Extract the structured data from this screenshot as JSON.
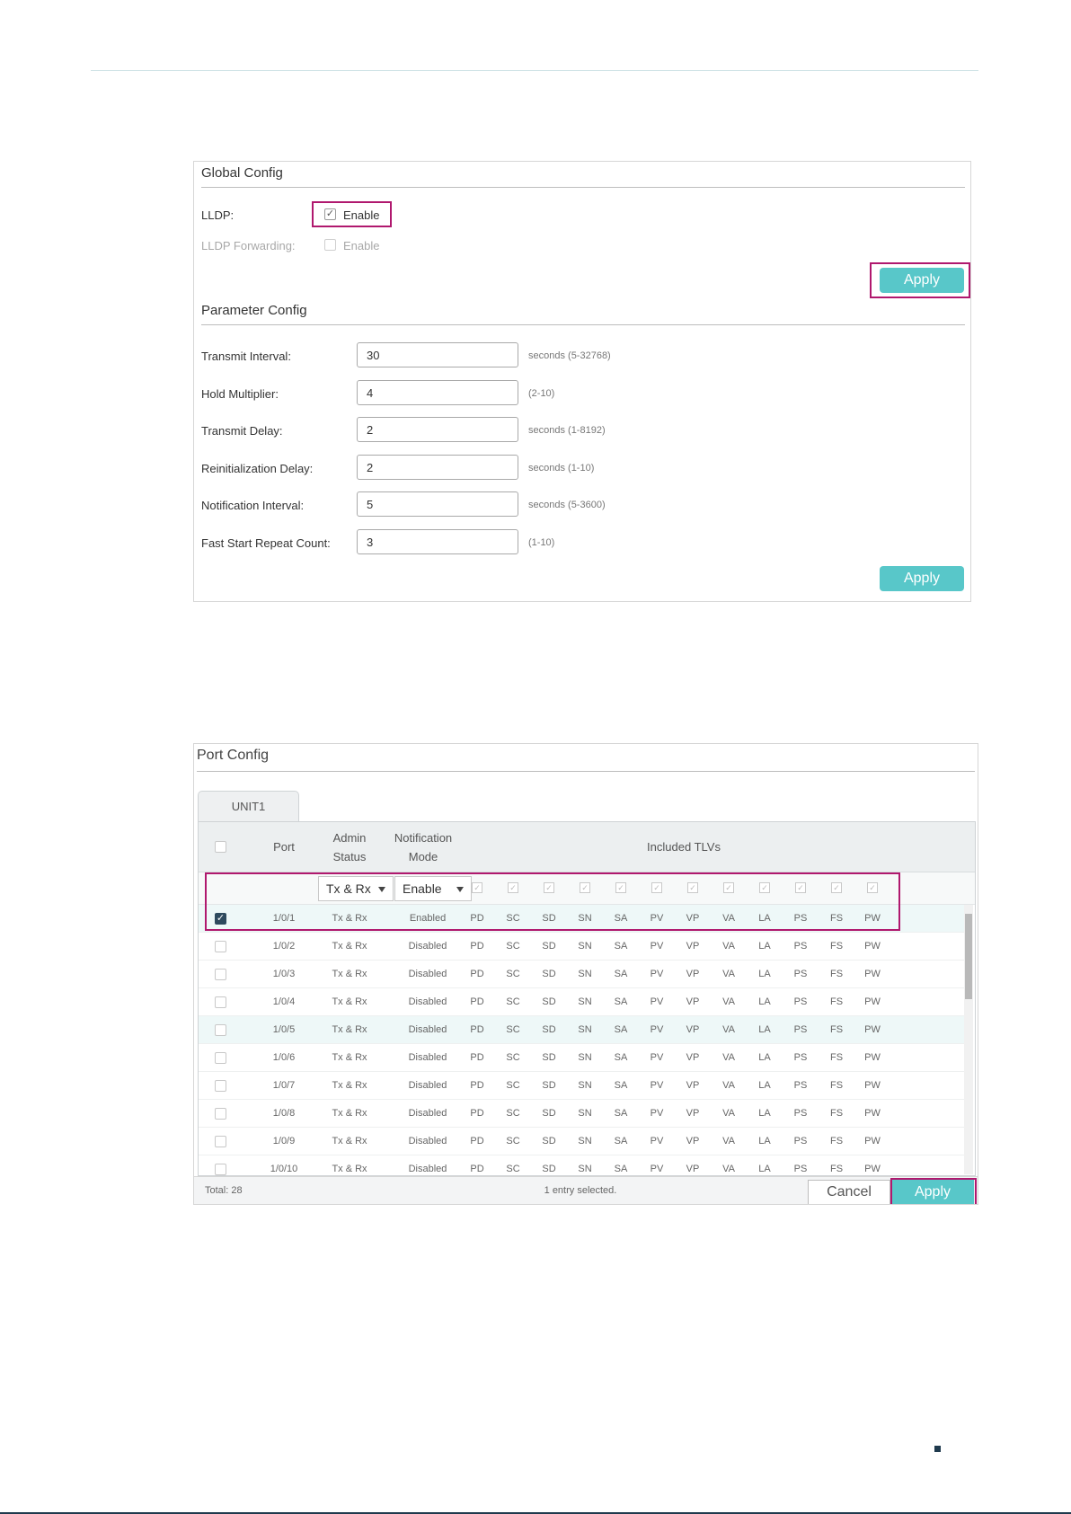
{
  "global_config": {
    "title": "Global Config",
    "lldp_label": "LLDP:",
    "lldp_enable_text": "Enable",
    "lldp_checked": true,
    "forwarding_label": "LLDP Forwarding:",
    "forwarding_enable_text": "Enable",
    "forwarding_checked": false,
    "apply_label": "Apply"
  },
  "parameter_config": {
    "title": "Parameter Config",
    "fields": [
      {
        "label": "Transmit Interval:",
        "value": "30",
        "hint": "seconds (5-32768)"
      },
      {
        "label": "Hold Multiplier:",
        "value": "4",
        "hint": "(2-10)"
      },
      {
        "label": "Transmit Delay:",
        "value": "2",
        "hint": "seconds (1-8192)"
      },
      {
        "label": "Reinitialization Delay:",
        "value": "2",
        "hint": "seconds (1-10)"
      },
      {
        "label": "Notification Interval:",
        "value": "5",
        "hint": "seconds (5-3600)"
      },
      {
        "label": "Fast Start Repeat Count:",
        "value": "3",
        "hint": "(1-10)"
      }
    ],
    "apply_label": "Apply"
  },
  "port_config": {
    "title": "Port Config",
    "tab": "UNIT1",
    "headers": {
      "port": "Port",
      "admin_status_1": "Admin",
      "admin_status_2": "Status",
      "notification_1": "Notification",
      "notification_2": "Mode",
      "tlvs": "Included TLVs"
    },
    "filter": {
      "admin_status": "Tx & Rx",
      "notification_mode": "Enable"
    },
    "tlvs": [
      "PD",
      "SC",
      "SD",
      "SN",
      "SA",
      "PV",
      "VP",
      "VA",
      "LA",
      "PS",
      "FS",
      "PW"
    ],
    "rows": [
      {
        "port": "1/0/1",
        "admin": "Tx & Rx",
        "mode": "Enabled",
        "checked": true
      },
      {
        "port": "1/0/2",
        "admin": "Tx & Rx",
        "mode": "Disabled",
        "checked": false
      },
      {
        "port": "1/0/3",
        "admin": "Tx & Rx",
        "mode": "Disabled",
        "checked": false
      },
      {
        "port": "1/0/4",
        "admin": "Tx & Rx",
        "mode": "Disabled",
        "checked": false
      },
      {
        "port": "1/0/5",
        "admin": "Tx & Rx",
        "mode": "Disabled",
        "checked": false
      },
      {
        "port": "1/0/6",
        "admin": "Tx & Rx",
        "mode": "Disabled",
        "checked": false
      },
      {
        "port": "1/0/7",
        "admin": "Tx & Rx",
        "mode": "Disabled",
        "checked": false
      },
      {
        "port": "1/0/8",
        "admin": "Tx & Rx",
        "mode": "Disabled",
        "checked": false
      },
      {
        "port": "1/0/9",
        "admin": "Tx & Rx",
        "mode": "Disabled",
        "checked": false
      },
      {
        "port": "1/0/10",
        "admin": "Tx & Rx",
        "mode": "Disabled",
        "checked": false
      }
    ],
    "footer": {
      "total": "Total: 28",
      "selected": "1 entry selected.",
      "cancel_label": "Cancel",
      "apply_label": "Apply"
    }
  },
  "colors": {
    "accent": "#58c7c9",
    "highlight": "#b0186e",
    "checked": "#2e4a5e"
  },
  "icons": {
    "checkbox": "check-icon",
    "dropdown": "chevron-down-icon"
  }
}
